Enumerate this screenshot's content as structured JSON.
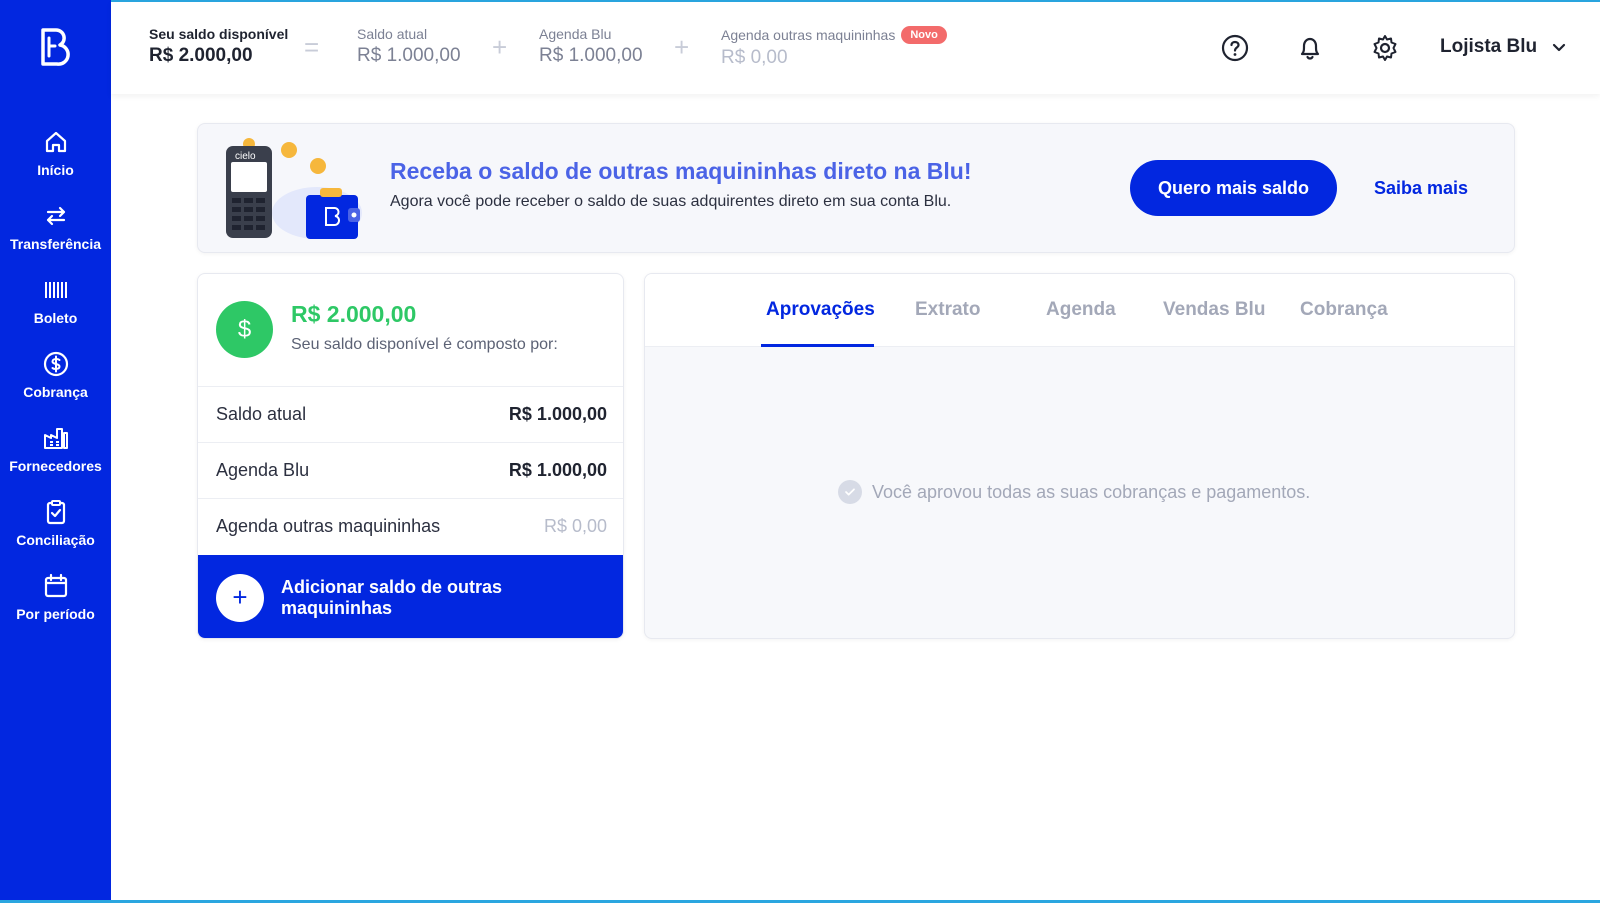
{
  "sidebar": {
    "items": [
      {
        "label": "Início",
        "icon": "home-icon"
      },
      {
        "label": "Transferência",
        "icon": "transfer-icon"
      },
      {
        "label": "Boleto",
        "icon": "barcode-icon"
      },
      {
        "label": "Cobrança",
        "icon": "dollar-circle-icon"
      },
      {
        "label": "Fornecedores",
        "icon": "factory-icon"
      },
      {
        "label": "Conciliação",
        "icon": "clipboard-check-icon"
      },
      {
        "label": "Por período",
        "icon": "calendar-icon"
      }
    ]
  },
  "header": {
    "available": {
      "title": "Seu saldo disponível",
      "value": "R$ 2.000,00"
    },
    "eq": "=",
    "current": {
      "title": "Saldo atual",
      "value": "R$ 1.000,00"
    },
    "plus1": "+",
    "agenda_blu": {
      "title": "Agenda Blu",
      "value": "R$ 1.000,00"
    },
    "plus2": "+",
    "agenda_other": {
      "title": "Agenda outras maquininhas",
      "badge": "Novo",
      "value": "R$ 0,00"
    },
    "user": "Lojista Blu"
  },
  "banner": {
    "title": "Receba o saldo de outras maquininhas direto na Blu!",
    "text": "Agora você pode receber o saldo de suas adquirentes direto em sua conta Blu.",
    "primary_button": "Quero mais saldo",
    "link": "Saiba mais",
    "machine_brand": "cielo"
  },
  "balance_card": {
    "icon_symbol": "$",
    "total": "R$ 2.000,00",
    "subtitle": "Seu saldo disponível é composto por:",
    "rows": [
      {
        "label": "Saldo atual",
        "value": "R$ 1.000,00"
      },
      {
        "label": "Agenda Blu",
        "value": "R$ 1.000,00"
      },
      {
        "label": "Agenda outras maquininhas",
        "value": "R$ 0,00"
      }
    ],
    "add_symbol": "+",
    "add_label": "Adicionar saldo de outras maquininhas"
  },
  "tabs": {
    "items": [
      "Aprovações",
      "Extrato",
      "Agenda",
      "Vendas Blu",
      "Cobrança"
    ],
    "active": "Aprovações",
    "empty_message": "Você aprovou todas as suas cobranças e pagamentos."
  },
  "colors": {
    "brand_blue": "#0227e0",
    "success_green": "#2ec866",
    "badge_red": "#f36b6b",
    "banner_title": "#4b63e6"
  }
}
